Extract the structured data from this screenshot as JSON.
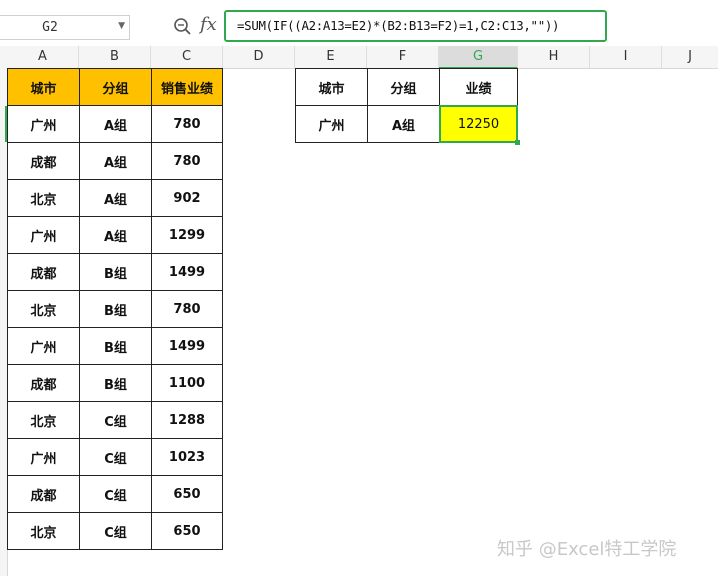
{
  "formula_bar": {
    "name_box": "G2",
    "fx_label": "fx",
    "formula": "=SUM(IF((A2:A13=E2)*(B2:B13=F2)=1,C2:C13,\"\"))"
  },
  "columns": [
    "A",
    "B",
    "C",
    "D",
    "E",
    "F",
    "G",
    "H",
    "I",
    "J"
  ],
  "active_column": "G",
  "table": {
    "headers": [
      "城市",
      "分组",
      "销售业绩"
    ],
    "rows": [
      [
        "广州",
        "A组",
        "780"
      ],
      [
        "成都",
        "A组",
        "780"
      ],
      [
        "北京",
        "A组",
        "902"
      ],
      [
        "广州",
        "A组",
        "1299"
      ],
      [
        "成都",
        "B组",
        "1499"
      ],
      [
        "北京",
        "B组",
        "780"
      ],
      [
        "广州",
        "B组",
        "1499"
      ],
      [
        "成都",
        "B组",
        "1100"
      ],
      [
        "北京",
        "C组",
        "1288"
      ],
      [
        "广州",
        "C组",
        "1023"
      ],
      [
        "成都",
        "C组",
        "650"
      ],
      [
        "北京",
        "C组",
        "650"
      ]
    ]
  },
  "lookup": {
    "headers": [
      "城市",
      "分组",
      "业绩"
    ],
    "values": [
      "广州",
      "A组",
      "12250"
    ]
  },
  "watermark": "知乎 @Excel特工学院",
  "colors": {
    "header_fill": "#ffc000",
    "result_fill": "#ffff00",
    "selection": "#2fa84f"
  }
}
